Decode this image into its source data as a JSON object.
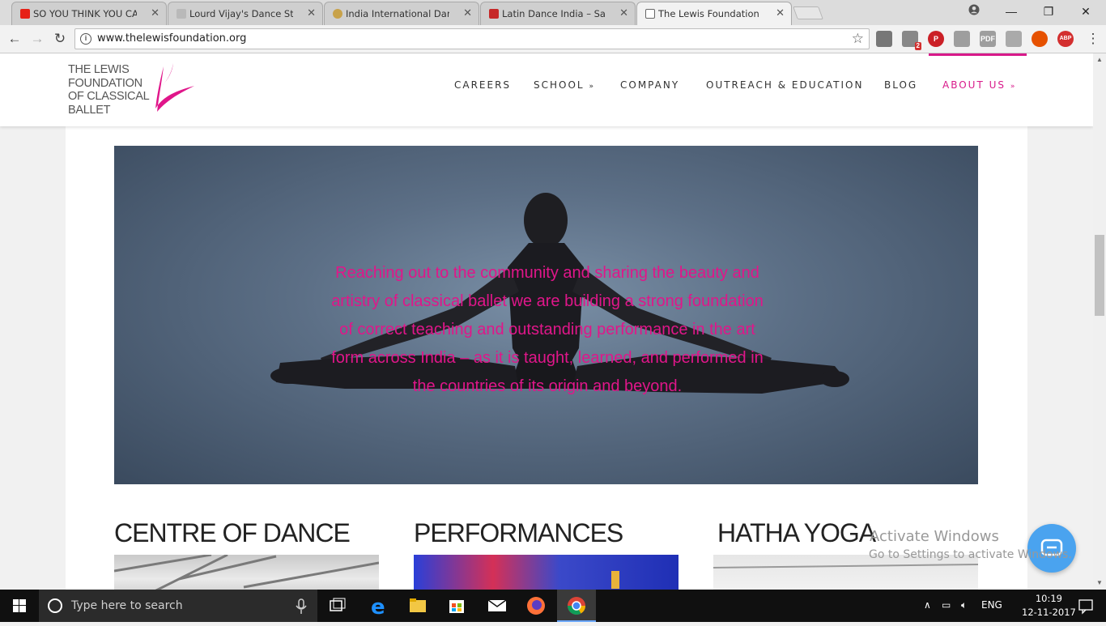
{
  "browser": {
    "tabs": [
      {
        "title": "SO YOU THINK YOU CAN",
        "favicon_color": "#e62117",
        "active": false
      },
      {
        "title": "Lourd Vijay's Dance Stud",
        "favicon_color": "#b9b9b9",
        "active": false
      },
      {
        "title": "India International Dance",
        "favicon_color": "#c8a24a",
        "active": false
      },
      {
        "title": "Latin Dance India – Salsa",
        "favicon_color": "#c62828",
        "active": false
      },
      {
        "title": "The Lewis Foundation of",
        "favicon_color": "#ffffff",
        "active": true
      }
    ],
    "url": "www.thelewisfoundation.org",
    "extension_badge": "2",
    "extensions": [
      {
        "name": "extension-icon-1",
        "color": "#777777",
        "label": ""
      },
      {
        "name": "extension-icon-2",
        "color": "#888888",
        "label": ""
      },
      {
        "name": "pinterest-icon",
        "color": "#cb2027",
        "label": "P"
      },
      {
        "name": "acrobat-icon",
        "color": "#9e9e9e",
        "label": ""
      },
      {
        "name": "pdf-icon",
        "color": "#9e9e9e",
        "label": "PDF"
      },
      {
        "name": "extension-icon-6",
        "color": "#aaaaaa",
        "label": ""
      },
      {
        "name": "fire-icon",
        "color": "#e65100",
        "label": ""
      },
      {
        "name": "adblock-icon",
        "color": "#d32f2f",
        "label": "ABP"
      }
    ]
  },
  "site": {
    "logo_lines": [
      "THE LEWIS",
      "FOUNDATION",
      "OF CLASSICAL",
      "BALLET"
    ],
    "accent_color": "#d8198a",
    "nav": [
      {
        "label": "CAREERS",
        "dropdown": false
      },
      {
        "label": "SCHOOL",
        "dropdown": true
      },
      {
        "label": "COMPANY",
        "dropdown": false
      },
      {
        "label": "OUTREACH & EDUCATION",
        "dropdown": false
      },
      {
        "label": "BLOG",
        "dropdown": false
      },
      {
        "label": "ABOUT US",
        "dropdown": true
      }
    ],
    "hero_text": "Reaching out to the community and sharing the beauty and artistry of classical ballet we are building a strong foundation of correct teaching and outstanding performance in the art form across India – as it is taught, learned, and performed in the countries of its origin and beyond.",
    "sections": [
      {
        "title": "CENTRE OF DANCE"
      },
      {
        "title": "PERFORMANCES"
      },
      {
        "title": "HATHA YOGA"
      }
    ],
    "watermark_line1": "Activate Windows",
    "watermark_line2": "Go to Settings to activate Windows."
  },
  "taskbar": {
    "search_placeholder": "Type here to search",
    "language": "ENG",
    "time": "10:19",
    "date": "12-11-2017"
  }
}
